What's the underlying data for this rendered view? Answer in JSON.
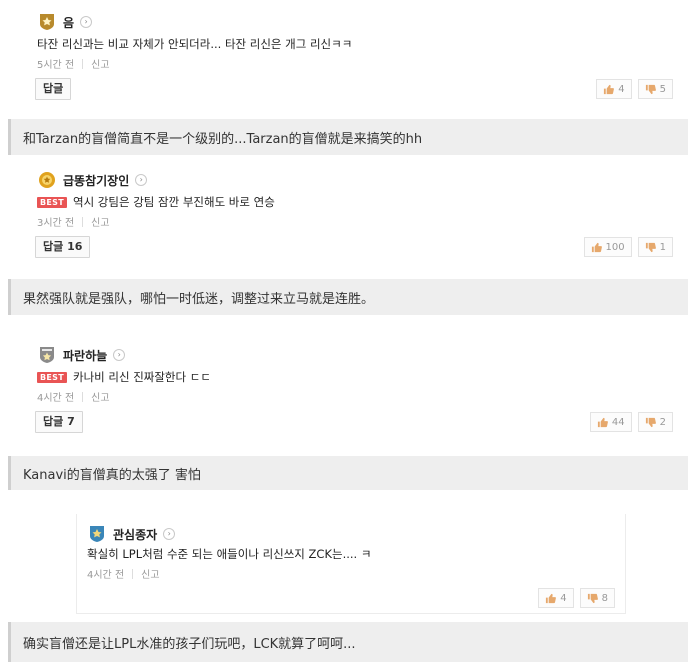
{
  "comments": [
    {
      "nickname": "음",
      "text": "타잔 리신과는 비교 자체가 안되더라... 타잔 리신은 개그 리신ㅋㅋ",
      "best": false,
      "time": "5시간 전",
      "report": "신고",
      "reply_label": "답글",
      "likes": "4",
      "dislikes": "5",
      "badge_color": "#b88a2c"
    },
    {
      "nickname": "급똥참기장인",
      "text": "역시 강팀은 강팀 잠깐 부진해도 바로 연승",
      "best": true,
      "best_label": "BEST",
      "time": "3시간 전",
      "report": "신고",
      "reply_label": "답글 16",
      "likes": "100",
      "dislikes": "1",
      "badge_color": "#e0a21e"
    },
    {
      "nickname": "파란하늘",
      "text": "카나비 리신 진짜잘한다 ㄷㄷ",
      "best": true,
      "best_label": "BEST",
      "time": "4시간 전",
      "report": "신고",
      "reply_label": "답글 7",
      "likes": "44",
      "dislikes": "2",
      "badge_color": "#8a8a8a"
    },
    {
      "nickname": "관심종자",
      "text": "확실히 LPL처럼 수준 되는 애들이나 리신쓰지 ZCK는.... ㅋ",
      "best": false,
      "time": "4시간 전",
      "report": "신고",
      "likes": "4",
      "dislikes": "8",
      "badge_color": "#3a86b8"
    }
  ],
  "captions": [
    "和Tarzan的盲僧简直不是一个级别的...Tarzan的盲僧就是来搞笑的hh",
    "果然强队就是强队，哪怕一时低迷，调整过来立马就是连胜。",
    "Kanavi的盲僧真的太强了 害怕",
    "确实盲僧还是让LPL水准的孩子们玩吧，LCK就算了呵呵..."
  ],
  "colors": {
    "best_tag": "#e95454",
    "caption_bg": "#eeeeee"
  }
}
